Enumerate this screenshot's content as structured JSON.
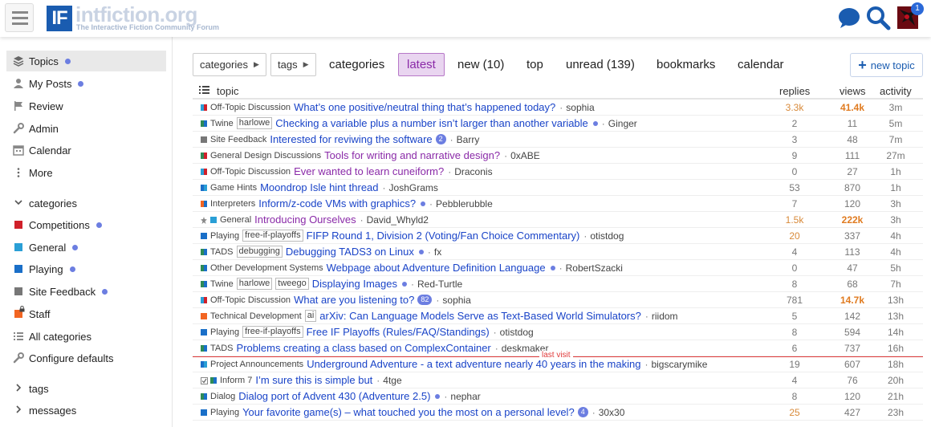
{
  "header": {
    "logo_box": "IF",
    "logo_name": "intfiction.org",
    "logo_tagline": "The Interactive Fiction Community Forum",
    "notification_count": "1"
  },
  "sidebar": {
    "items": [
      {
        "label": "Topics",
        "icon": "layers-icon",
        "dot": true,
        "active": true
      },
      {
        "label": "My Posts",
        "icon": "user-icon",
        "dot": true
      },
      {
        "label": "Review",
        "icon": "flag-icon"
      },
      {
        "label": "Admin",
        "icon": "wrench-icon"
      },
      {
        "label": "Calendar",
        "icon": "calendar-icon"
      },
      {
        "label": "More",
        "icon": "ellipsis-icon"
      }
    ],
    "categories_label": "categories",
    "categories": [
      {
        "label": "Competitions",
        "color": "#d0202a",
        "dot": true
      },
      {
        "label": "General",
        "color": "#2a9fd6",
        "dot": true
      },
      {
        "label": "Playing",
        "color": "#1a6fc8",
        "dot": true
      },
      {
        "label": "Site Feedback",
        "color": "#777777",
        "dot": true
      },
      {
        "label": "Staff",
        "color": "#f26522",
        "dot": false
      }
    ],
    "all_categories": "All categories",
    "configure_defaults": "Configure defaults",
    "tags_label": "tags",
    "messages_label": "messages"
  },
  "nav": {
    "categories_dd": "categories",
    "tags_dd": "tags",
    "links": [
      "categories",
      "latest",
      "new (10)",
      "top",
      "unread (139)",
      "bookmarks",
      "calendar"
    ],
    "active": "latest",
    "new_topic": "new topic"
  },
  "table": {
    "h_topic": "topic",
    "h_replies": "replies",
    "h_views": "views",
    "h_activity": "activity",
    "last_visit": "last visit"
  },
  "topics": [
    {
      "cat": "Off-Topic Discussion",
      "colors": [
        "#2a9fd6",
        "#d0202a"
      ],
      "tags": [],
      "title": "What’s one positive/neutral thing that’s happened today?",
      "visited": false,
      "dot": false,
      "badge": "",
      "poster": "sophia",
      "replies": "3.3k",
      "views": "41.4k",
      "activity": "3m",
      "rep_hot": "warm",
      "views_hot": "hot"
    },
    {
      "cat": "Twine",
      "colors": [
        "#2e8b57",
        "#1a6fc8"
      ],
      "tags": [
        "harlowe"
      ],
      "title": "Checking a variable plus a number isn’t larger than another variable",
      "visited": false,
      "dot": true,
      "badge": "",
      "poster": "Ginger",
      "replies": "2",
      "views": "11",
      "activity": "5m"
    },
    {
      "cat": "Site Feedback",
      "colors": [
        "#777777"
      ],
      "tags": [],
      "title": "Interested for reviwing the software",
      "visited": false,
      "dot": false,
      "badge": "2",
      "poster": "Barry",
      "replies": "3",
      "views": "48",
      "activity": "7m"
    },
    {
      "cat": "General Design Discussions",
      "colors": [
        "#2e8b57",
        "#d0202a"
      ],
      "tags": [],
      "title": "Tools for writing and narrative design?",
      "visited": true,
      "dot": false,
      "badge": "",
      "poster": "0xABE",
      "replies": "9",
      "views": "111",
      "activity": "27m"
    },
    {
      "cat": "Off-Topic Discussion",
      "colors": [
        "#2a9fd6",
        "#d0202a"
      ],
      "tags": [],
      "title": "Ever wanted to learn cuneiform?",
      "visited": true,
      "dot": false,
      "badge": "",
      "poster": "Draconis",
      "replies": "0",
      "views": "27",
      "activity": "1h"
    },
    {
      "cat": "Game Hints",
      "colors": [
        "#1a6fc8",
        "#2a9fd6"
      ],
      "tags": [],
      "title": "Moondrop Isle hint thread",
      "visited": false,
      "dot": false,
      "badge": "",
      "poster": "JoshGrams",
      "replies": "53",
      "views": "870",
      "activity": "1h"
    },
    {
      "cat": "Interpreters",
      "colors": [
        "#f26522",
        "#1a6fc8"
      ],
      "tags": [],
      "title": "Inform/z-code VMs with graphics?",
      "visited": false,
      "dot": true,
      "badge": "",
      "poster": "Pebblerubble",
      "replies": "7",
      "views": "120",
      "activity": "3h"
    },
    {
      "cat": "General",
      "colors": [
        "#2a9fd6"
      ],
      "pinned": true,
      "tags": [],
      "title": "Introducing Ourselves",
      "visited": true,
      "dot": false,
      "badge": "",
      "poster": "David_Whyld2",
      "replies": "1.5k",
      "views": "222k",
      "activity": "3h",
      "rep_hot": "warm",
      "views_hot": "hot"
    },
    {
      "cat": "Playing",
      "colors": [
        "#1a6fc8"
      ],
      "tags": [
        "free-if-playoffs"
      ],
      "title": "FIFP Round 1, Division 2 (Voting/Fan Choice Commentary)",
      "visited": false,
      "dot": false,
      "badge": "",
      "poster": "otistdog",
      "replies": "20",
      "views": "337",
      "activity": "4h",
      "rep_hot": "warm"
    },
    {
      "cat": "TADS",
      "colors": [
        "#2e8b57",
        "#1a6fc8"
      ],
      "tags": [
        "debugging"
      ],
      "title": "Debugging TADS3 on Linux",
      "visited": false,
      "dot": true,
      "badge": "",
      "poster": "fx",
      "replies": "4",
      "views": "113",
      "activity": "4h"
    },
    {
      "cat": "Other Development Systems",
      "colors": [
        "#2e8b57",
        "#1a6fc8"
      ],
      "tags": [],
      "title": "Webpage about Adventure Definition Language",
      "visited": false,
      "dot": true,
      "badge": "",
      "poster": "RobertSzacki",
      "replies": "0",
      "views": "47",
      "activity": "5h"
    },
    {
      "cat": "Twine",
      "colors": [
        "#2e8b57",
        "#1a6fc8"
      ],
      "tags": [
        "harlowe",
        "tweego"
      ],
      "title": "Displaying Images",
      "visited": false,
      "dot": true,
      "badge": "",
      "poster": "Red-Turtle",
      "replies": "8",
      "views": "68",
      "activity": "7h"
    },
    {
      "cat": "Off-Topic Discussion",
      "colors": [
        "#2a9fd6",
        "#d0202a"
      ],
      "tags": [],
      "title": "What are you listening to?",
      "visited": false,
      "dot": false,
      "badge": "82",
      "poster": "sophia",
      "replies": "781",
      "views": "14.7k",
      "activity": "13h",
      "views_hot": "hot"
    },
    {
      "cat": "Technical Development",
      "colors": [
        "#f26522"
      ],
      "tags": [
        "ai"
      ],
      "title": "arXiv: Can Language Models Serve as Text-Based World Simulators?",
      "visited": false,
      "dot": false,
      "badge": "",
      "poster": "riidom",
      "replies": "5",
      "views": "142",
      "activity": "13h"
    },
    {
      "cat": "Playing",
      "colors": [
        "#1a6fc8"
      ],
      "tags": [
        "free-if-playoffs"
      ],
      "title": "Free IF Playoffs (Rules/FAQ/Standings)",
      "visited": false,
      "dot": false,
      "badge": "",
      "poster": "otistdog",
      "replies": "8",
      "views": "594",
      "activity": "14h"
    },
    {
      "cat": "TADS",
      "colors": [
        "#2e8b57",
        "#1a6fc8"
      ],
      "tags": [],
      "title": "Problems creating a class based on ComplexContainer",
      "visited": false,
      "dot": false,
      "badge": "",
      "poster": "deskmaker",
      "replies": "6",
      "views": "737",
      "activity": "16h",
      "last_visit_after": true
    },
    {
      "cat": "Project Announcements",
      "colors": [
        "#1a6fc8",
        "#2a9fd6"
      ],
      "tags": [],
      "title": "Underground Adventure - a text adventure nearly 40 years in the making",
      "visited": false,
      "dot": false,
      "badge": "",
      "poster": "bigscarymike",
      "replies": "19",
      "views": "607",
      "activity": "18h"
    },
    {
      "cat": "Inform 7",
      "colors": [
        "#2e8b57",
        "#1a6fc8"
      ],
      "checkbox": true,
      "tags": [],
      "title": "I’m sure this is simple but",
      "visited": false,
      "dot": false,
      "badge": "",
      "poster": "4tge",
      "replies": "4",
      "views": "76",
      "activity": "20h"
    },
    {
      "cat": "Dialog",
      "colors": [
        "#2e8b57",
        "#1a6fc8"
      ],
      "tags": [],
      "title": "Dialog port of Advent 430 (Adventure 2.5)",
      "visited": false,
      "dot": true,
      "badge": "",
      "poster": "nephar",
      "replies": "8",
      "views": "120",
      "activity": "21h"
    },
    {
      "cat": "Playing",
      "colors": [
        "#1a6fc8"
      ],
      "tags": [],
      "title": "Your favorite game(s) – what touched you the most on a personal level?",
      "visited": false,
      "dot": false,
      "badge": "4",
      "poster": "30x30",
      "replies": "25",
      "views": "427",
      "activity": "23h",
      "rep_hot": "warm"
    }
  ]
}
